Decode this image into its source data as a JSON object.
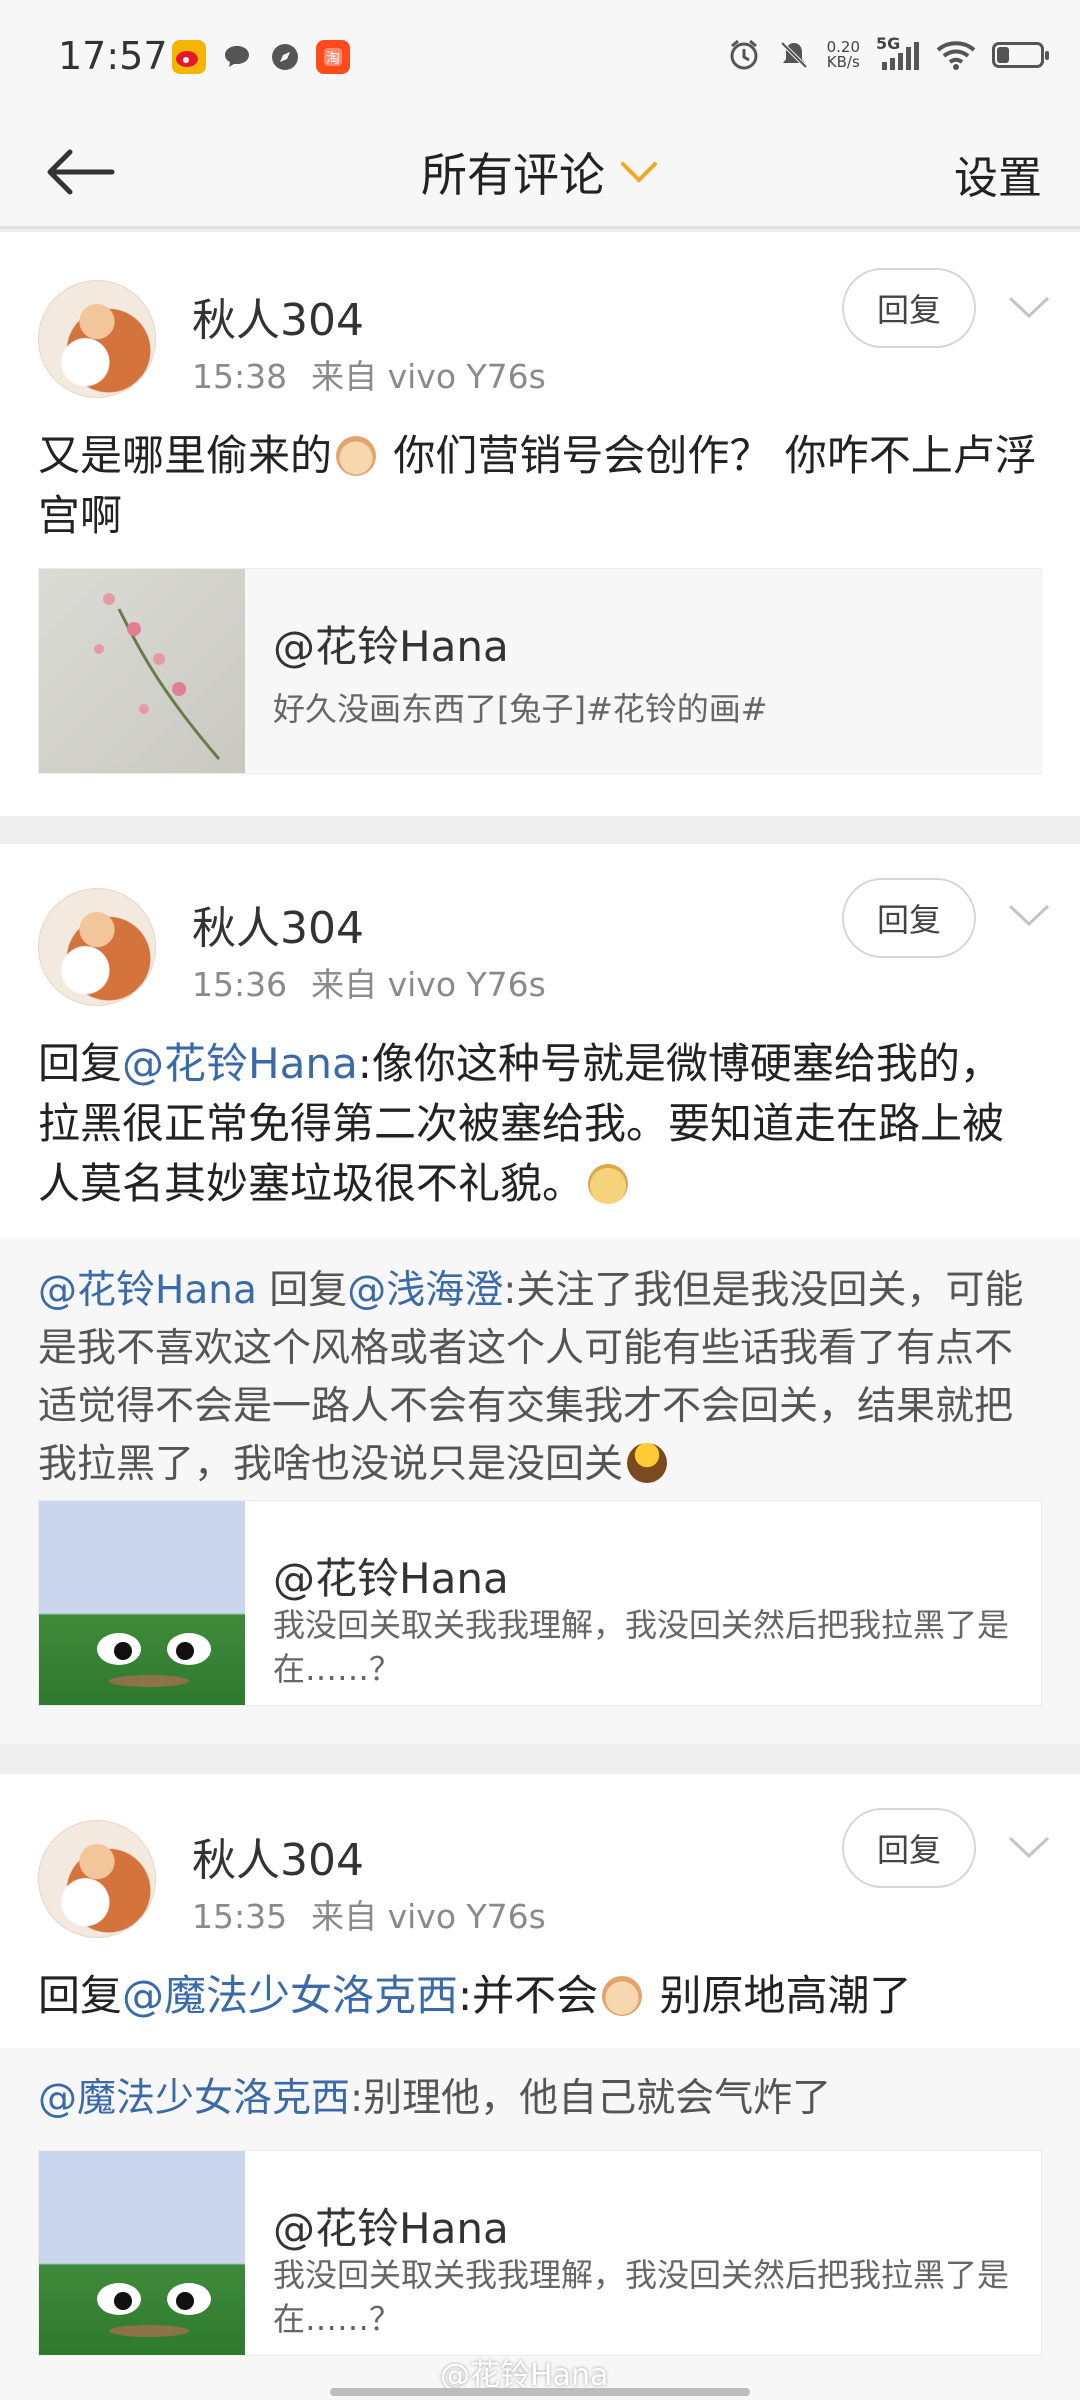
{
  "status_bar": {
    "time": "17:57",
    "net_speed_value": "0.20",
    "net_speed_unit": "KB/s",
    "signal_label": "5G",
    "app_icons": [
      "weibo-icon",
      "message-icon",
      "compass-icon",
      "taobao-icon"
    ],
    "right_icons": [
      "alarm-icon",
      "mute-icon",
      "signal-icon",
      "wifi-icon",
      "battery-icon"
    ]
  },
  "navbar": {
    "title": "所有评论",
    "settings": "设置",
    "accent_color": "#f5a623"
  },
  "comments": [
    {
      "user": "秋人304",
      "time": "15:38",
      "source": "来自 vivo Y76s",
      "reply_label": "回复",
      "text_before": "又是哪里偷来的",
      "text_after": " 你们营销号会创作？ 你咋不上卢浮宫啊",
      "share": {
        "title": "@花铃Hana",
        "desc": "好久没画东西了[兔子]#花铃的画#"
      }
    },
    {
      "user": "秋人304",
      "time": "15:36",
      "source": "来自 vivo Y76s",
      "reply_label": "回复",
      "reply_prefix": "回复",
      "mention": "@花铃Hana",
      "text": ":像你这种号就是微博硬塞给我的，拉黑很正常免得第二次被塞给我。要知道走在路上被人莫名其妙塞垃圾很不礼貌。",
      "quoted": {
        "author": "@花铃Hana",
        "reply_word": " 回复",
        "target": "@浅海澄",
        "text": ":关注了我但是我没回关，可能是我不喜欢这个风格或者这个人可能有些话我看了有点不适觉得不会是一路人不会有交集我才不会回关，结果就把我拉黑了，我啥也没说只是没回关"
      },
      "share": {
        "title": "@花铃Hana",
        "desc": "我没回关取关我我理解，我没回关然后把我拉黑了是在……？"
      }
    },
    {
      "user": "秋人304",
      "time": "15:35",
      "source": "来自 vivo Y76s",
      "reply_label": "回复",
      "reply_prefix": "回复",
      "mention": "@魔法少女洛克西",
      "text_before": ":并不会",
      "text_after": " 别原地高潮了",
      "quoted": {
        "author": "@魔法少女洛克西",
        "text": ":别理他，他自己就会气炸了"
      },
      "share": {
        "title": "@花铃Hana",
        "desc": "我没回关取关我我理解，我没回关然后把我拉黑了是在……？"
      }
    }
  ],
  "watermark": "@花铃Hana"
}
